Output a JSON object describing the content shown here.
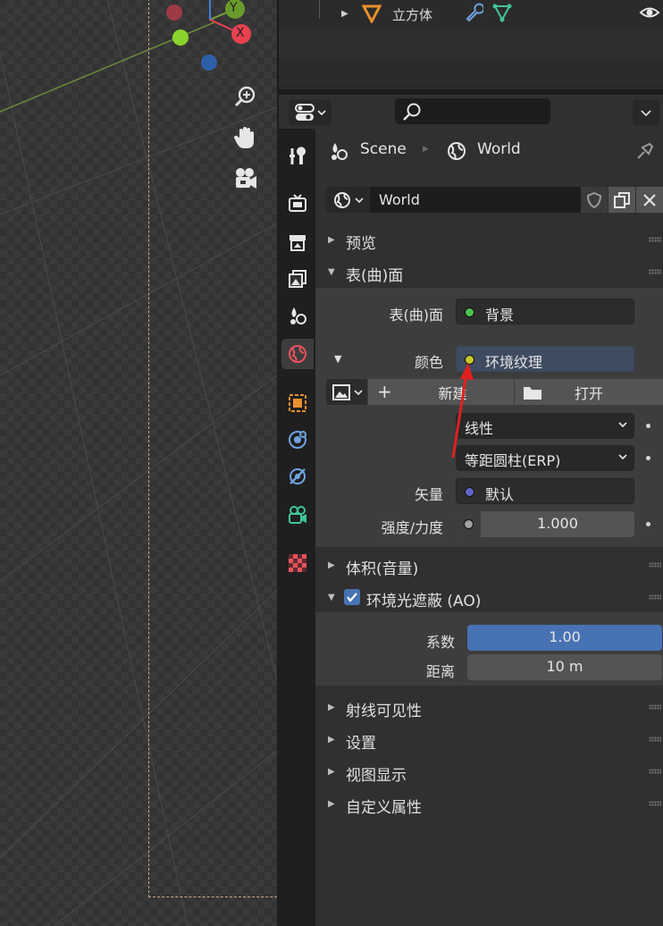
{
  "outliner": {
    "object_label": "立方体"
  },
  "viewport": {
    "axis_y": "Y",
    "axis_x": "X"
  },
  "properties": {
    "breadcrumb": {
      "scene": "Scene",
      "world": "World"
    },
    "world_name": "World",
    "sections": {
      "preview": "预览",
      "surface": "表(曲)面",
      "volume": "体积(音量)",
      "ao": "环境光遮蔽 (AO)",
      "ray_visibility": "射线可见性",
      "settings": "设置",
      "viewport_display": "视图显示",
      "custom_props": "自定义属性"
    },
    "surface": {
      "surface_label": "表(曲)面",
      "surface_value": "背景",
      "color_label": "颜色",
      "color_value": "环境纹理",
      "new_button": "新建",
      "open_button": "打开",
      "interpolation": "线性",
      "projection": "等距圆柱(ERP)",
      "vector_label": "矢量",
      "vector_value": "默认",
      "strength_label": "强度/力度",
      "strength_value": "1.000"
    },
    "ao": {
      "factor_label": "系数",
      "factor_value": "1.00",
      "distance_label": "距离",
      "distance_value": "10 m"
    }
  },
  "colors": {
    "accent_blue": "#4772b3",
    "socket_green": "#4ec24e",
    "socket_yellow": "#c7c729",
    "socket_purple": "#6363c7",
    "socket_gray": "#a1a1a1",
    "annotation_red": "#e02020"
  }
}
